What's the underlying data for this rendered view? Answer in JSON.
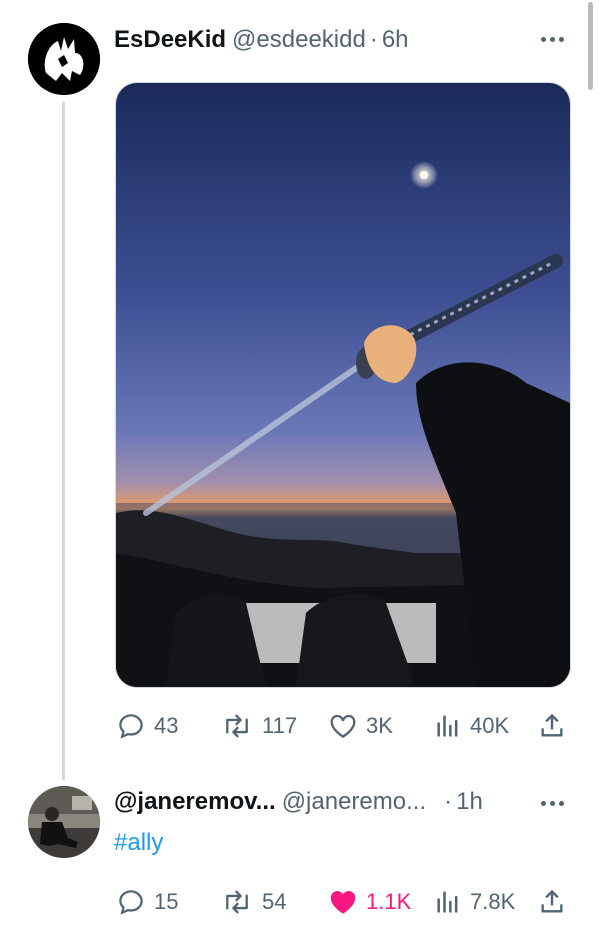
{
  "tweet": {
    "display_name": "EsDeeKid",
    "handle": "@esdeekidd",
    "separator": "·",
    "time": "6h",
    "stats": {
      "replies": "43",
      "reposts": "117",
      "likes": "3K",
      "views": "40K"
    }
  },
  "reply": {
    "display_name": "@janeremov...",
    "handle": "@janeremo...",
    "separator": "·",
    "time": "1h",
    "text": "#ally",
    "stats": {
      "replies": "15",
      "reposts": "54",
      "likes": "1.1K",
      "views": "7.8K"
    },
    "liked": true
  },
  "colors": {
    "text": "#0f1419",
    "muted": "#536471",
    "link": "#1d9bf0",
    "like_active": "#f91880"
  },
  "icons": [
    "avatar-icon",
    "more-icon",
    "reply-icon",
    "repost-icon",
    "like-icon",
    "views-icon",
    "share-icon"
  ]
}
